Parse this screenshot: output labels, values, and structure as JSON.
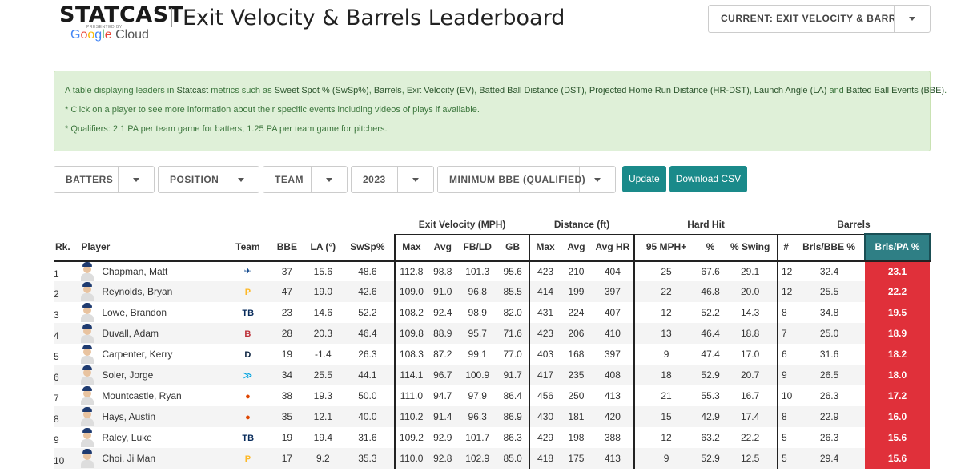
{
  "header": {
    "logo_text": "STATCAST",
    "logo_presented": "PRESENTED BY",
    "logo_sponsor": "Google Cloud",
    "title": "Exit Velocity & Barrels Leaderboard",
    "view_select": "CURRENT: EXIT VELOCITY & BARRELS"
  },
  "info": {
    "line1_parts": [
      "A table displaying leaders in ",
      "Statcast",
      " metrics such as ",
      "Sweet Spot % (SwSp%)",
      ", ",
      "Barrels",
      ", ",
      "Exit Velocity (EV)",
      ", ",
      "Batted Ball Distance (DST)",
      ", ",
      "Projected Home Run Distance (HR-DST)",
      ", ",
      "Launch Angle (LA)",
      " and ",
      "Batted Ball Events (BBE)",
      "."
    ],
    "line2": "* Click on a player to see more information about their specific events including videos of plays if available.",
    "line3": "* Qualifiers: 2.1 PA per team game for batters, 1.25 PA per team game for pitchers."
  },
  "filters": {
    "type": "BATTERS",
    "position": "POSITION",
    "team": "TEAM",
    "year": "2023",
    "min_bbe": "MINIMUM BBE (QUALIFIED)",
    "update_label": "Update",
    "download_label": "Download CSV"
  },
  "table": {
    "groups": {
      "exit_velocity": "Exit Velocity (MPH)",
      "distance": "Distance (ft)",
      "hard_hit": "Hard Hit",
      "barrels": "Barrels"
    },
    "columns": {
      "rk": "Rk.",
      "player": "Player",
      "team": "Team",
      "bbe": "BBE",
      "la": "LA (°)",
      "swsp": "SwSp%",
      "ev_max": "Max",
      "ev_avg": "Avg",
      "ev_fbld": "FB/LD",
      "ev_gb": "GB",
      "dist_max": "Max",
      "dist_avg": "Avg",
      "dist_avghr": "Avg HR",
      "hh_95": "95 MPH+",
      "hh_pct": "%",
      "hh_swing": "% Swing",
      "brl_num": "#",
      "brl_bbe": "Brls/BBE %",
      "brl_pa": "Brls/PA %"
    },
    "rows": [
      {
        "rk": "1",
        "player": "Chapman, Matt",
        "team_icon": "blue-jays-logo",
        "team_color": "#134a8e",
        "team_glyph": "✈",
        "bbe": "37",
        "la": "15.6",
        "swsp": "48.6",
        "ev_max": "112.8",
        "ev_avg": "98.8",
        "ev_fbld": "101.3",
        "ev_gb": "95.6",
        "dist_max": "423",
        "dist_avg": "210",
        "dist_avghr": "404",
        "hh_95": "25",
        "hh_pct": "67.6",
        "hh_swing": "29.1",
        "brl_num": "12",
        "brl_bbe": "32.4",
        "brl_pa": "23.1"
      },
      {
        "rk": "2",
        "player": "Reynolds, Bryan",
        "team_icon": "pirates-logo",
        "team_color": "#fdb827",
        "team_glyph": "P",
        "bbe": "47",
        "la": "19.0",
        "swsp": "42.6",
        "ev_max": "109.0",
        "ev_avg": "91.0",
        "ev_fbld": "96.8",
        "ev_gb": "85.5",
        "dist_max": "414",
        "dist_avg": "199",
        "dist_avghr": "397",
        "hh_95": "22",
        "hh_pct": "46.8",
        "hh_swing": "20.0",
        "brl_num": "12",
        "brl_bbe": "25.5",
        "brl_pa": "22.2"
      },
      {
        "rk": "3",
        "player": "Lowe, Brandon",
        "team_icon": "rays-logo",
        "team_color": "#092c5c",
        "team_glyph": "TB",
        "bbe": "23",
        "la": "14.6",
        "swsp": "52.2",
        "ev_max": "108.2",
        "ev_avg": "92.4",
        "ev_fbld": "98.9",
        "ev_gb": "82.0",
        "dist_max": "431",
        "dist_avg": "224",
        "dist_avghr": "407",
        "hh_95": "12",
        "hh_pct": "52.2",
        "hh_swing": "14.3",
        "brl_num": "8",
        "brl_bbe": "34.8",
        "brl_pa": "19.5"
      },
      {
        "rk": "4",
        "player": "Duvall, Adam",
        "team_icon": "red-sox-logo",
        "team_color": "#bd3039",
        "team_glyph": "B",
        "bbe": "28",
        "la": "20.3",
        "swsp": "46.4",
        "ev_max": "109.8",
        "ev_avg": "88.9",
        "ev_fbld": "95.7",
        "ev_gb": "71.6",
        "dist_max": "423",
        "dist_avg": "206",
        "dist_avghr": "410",
        "hh_95": "13",
        "hh_pct": "46.4",
        "hh_swing": "18.8",
        "brl_num": "7",
        "brl_bbe": "25.0",
        "brl_pa": "18.9"
      },
      {
        "rk": "5",
        "player": "Carpenter, Kerry",
        "team_icon": "tigers-logo",
        "team_color": "#0c2340",
        "team_glyph": "D",
        "bbe": "19",
        "la": "-1.4",
        "swsp": "26.3",
        "ev_max": "108.3",
        "ev_avg": "87.2",
        "ev_fbld": "99.1",
        "ev_gb": "77.0",
        "dist_max": "403",
        "dist_avg": "168",
        "dist_avghr": "397",
        "hh_95": "9",
        "hh_pct": "47.4",
        "hh_swing": "17.0",
        "brl_num": "6",
        "brl_bbe": "31.6",
        "brl_pa": "18.2"
      },
      {
        "rk": "6",
        "player": "Soler, Jorge",
        "team_icon": "marlins-logo",
        "team_color": "#00a3e0",
        "team_glyph": "≫",
        "bbe": "34",
        "la": "25.5",
        "swsp": "44.1",
        "ev_max": "114.1",
        "ev_avg": "96.7",
        "ev_fbld": "100.9",
        "ev_gb": "91.7",
        "dist_max": "417",
        "dist_avg": "235",
        "dist_avghr": "408",
        "hh_95": "18",
        "hh_pct": "52.9",
        "hh_swing": "20.7",
        "brl_num": "9",
        "brl_bbe": "26.5",
        "brl_pa": "18.0"
      },
      {
        "rk": "7",
        "player": "Mountcastle, Ryan",
        "team_icon": "orioles-logo",
        "team_color": "#df4601",
        "team_glyph": "●",
        "bbe": "38",
        "la": "19.3",
        "swsp": "50.0",
        "ev_max": "111.0",
        "ev_avg": "94.7",
        "ev_fbld": "97.9",
        "ev_gb": "86.4",
        "dist_max": "456",
        "dist_avg": "250",
        "dist_avghr": "413",
        "hh_95": "21",
        "hh_pct": "55.3",
        "hh_swing": "16.7",
        "brl_num": "10",
        "brl_bbe": "26.3",
        "brl_pa": "17.2"
      },
      {
        "rk": "8",
        "player": "Hays, Austin",
        "team_icon": "orioles-logo",
        "team_color": "#df4601",
        "team_glyph": "●",
        "bbe": "35",
        "la": "12.1",
        "swsp": "40.0",
        "ev_max": "110.2",
        "ev_avg": "91.4",
        "ev_fbld": "96.3",
        "ev_gb": "86.9",
        "dist_max": "430",
        "dist_avg": "181",
        "dist_avghr": "420",
        "hh_95": "15",
        "hh_pct": "42.9",
        "hh_swing": "17.4",
        "brl_num": "8",
        "brl_bbe": "22.9",
        "brl_pa": "16.0"
      },
      {
        "rk": "9",
        "player": "Raley, Luke",
        "team_icon": "rays-logo",
        "team_color": "#092c5c",
        "team_glyph": "TB",
        "bbe": "19",
        "la": "19.4",
        "swsp": "31.6",
        "ev_max": "109.2",
        "ev_avg": "92.9",
        "ev_fbld": "101.7",
        "ev_gb": "86.3",
        "dist_max": "429",
        "dist_avg": "198",
        "dist_avghr": "388",
        "hh_95": "12",
        "hh_pct": "63.2",
        "hh_swing": "22.2",
        "brl_num": "5",
        "brl_bbe": "26.3",
        "brl_pa": "15.6"
      },
      {
        "rk": "10",
        "player": "Choi, Ji Man",
        "team_icon": "pirates-logo",
        "team_color": "#fdb827",
        "team_glyph": "P",
        "bbe": "17",
        "la": "9.2",
        "swsp": "35.3",
        "ev_max": "110.0",
        "ev_avg": "92.8",
        "ev_fbld": "102.9",
        "ev_gb": "85.0",
        "dist_max": "418",
        "dist_avg": "175",
        "dist_avghr": "413",
        "hh_95": "9",
        "hh_pct": "52.9",
        "hh_swing": "12.5",
        "brl_num": "5",
        "brl_bbe": "29.4",
        "brl_pa": "15.6"
      }
    ]
  },
  "colors": {
    "accent_teal": "#1a8a8a",
    "highlight_red": "#e0303a",
    "info_green_bg": "#dff0d8"
  }
}
